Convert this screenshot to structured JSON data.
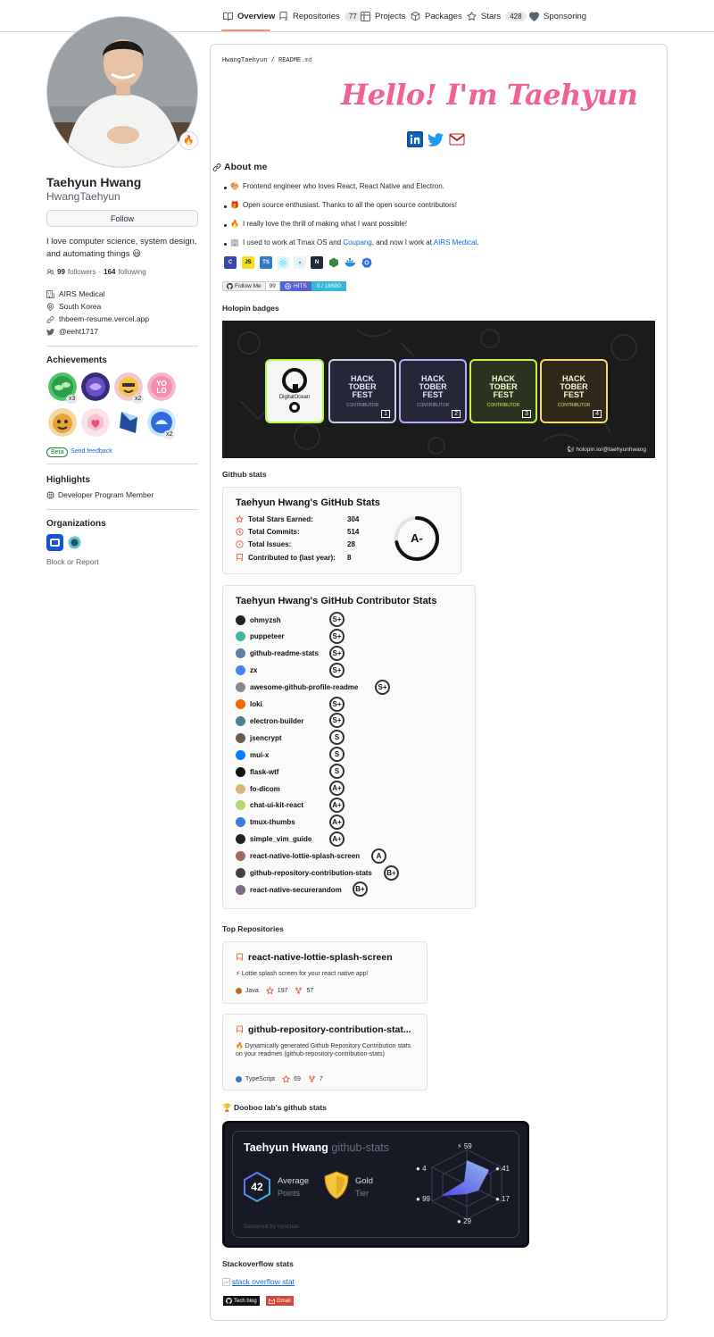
{
  "nav": {
    "overview": "Overview",
    "repositories": "Repositories",
    "repositories_count": "77",
    "projects": "Projects",
    "packages": "Packages",
    "stars": "Stars",
    "stars_count": "428",
    "sponsoring": "Sponsoring"
  },
  "profile": {
    "status_emoji": "🔥",
    "name": "Taehyun Hwang",
    "login": "HwangTaehyun",
    "follow": "Follow",
    "bio": "I love computer science, system design, and automating things 😃",
    "followers_count": "99",
    "followers_label": "followers",
    "separator": "·",
    "following_count": "164",
    "following_label": "following",
    "company": "AIRS Medical",
    "location": "South Korea",
    "website": "thbeem-resume.vercel.app",
    "twitter": "@eeht1717"
  },
  "achievements": {
    "title": "Achievements",
    "badges": [
      {
        "name": "Pair Extraordinaire",
        "count": "x3"
      },
      {
        "name": "Galaxy Brain",
        "count": ""
      },
      {
        "name": "Quickdraw",
        "count": "x2"
      },
      {
        "name": "YOLO",
        "count": ""
      },
      {
        "name": "Starstruck",
        "count": ""
      },
      {
        "name": "Public Sponsor",
        "count": ""
      },
      {
        "name": "Arctic Code Vault",
        "count": ""
      },
      {
        "name": "Pull Shark",
        "count": "x2"
      }
    ],
    "beta": "Beta",
    "feedback": "Send feedback"
  },
  "highlights": {
    "title": "Highlights",
    "item": "Developer Program Member"
  },
  "organizations": {
    "title": "Organizations",
    "block": "Block or Report"
  },
  "readme": {
    "path_user": "HwangTaehyun",
    "path_sep": " / ",
    "path_file": "README",
    "path_ext": ".md",
    "hello": "Hello! I'm Taehyun",
    "about_title": "About me",
    "bullets": [
      {
        "emoji": "🎨",
        "text": "Frontend engineer who loves React, React Native and Electron."
      },
      {
        "emoji": "🎁",
        "text": "Open source enthusiast. Thanks to all the open source contributors!"
      },
      {
        "emoji": "🔥",
        "text": "I really love the thrill of making what I want possible!"
      },
      {
        "emoji": "🏢",
        "text_before": "I used to work at Tmax OS and ",
        "link1": "Coupang",
        "text_mid": ", and now I work at ",
        "link2": "AIRS Medical",
        "text_after": "."
      }
    ],
    "tech_icons": [
      "C",
      "JS",
      "TS",
      "React",
      "Electron",
      "Next",
      "Node",
      "Docker",
      "K8s"
    ],
    "follow_badge_label": "Follow Me",
    "follow_badge_count": "99",
    "hits_label": "HITS",
    "hits_value": "0 / 16680",
    "holopin_title": "Holopin badges",
    "holopin_caption": "holopin.io/@taehyunhwang",
    "holopin_badges": [
      {
        "title": "DigitalOcean",
        "sub": ""
      },
      {
        "title": "HACK TOBER FEST",
        "sub": "CONTRIBUTOR",
        "level": "1"
      },
      {
        "title": "HACK TOBER FEST",
        "sub": "CONTRIBUTOR",
        "level": "2"
      },
      {
        "title": "HACK TOBER FEST",
        "sub": "CONTRIBUTOR",
        "level": "3"
      },
      {
        "title": "HACK TOBER FEST",
        "sub": "CONTRIBUTOR",
        "level": "4"
      }
    ],
    "github_stats_title": "Github stats"
  },
  "stats": {
    "title": "Taehyun Hwang's GitHub Stats",
    "rows": [
      {
        "label": "Total Stars Earned:",
        "value": "304"
      },
      {
        "label": "Total Commits:",
        "value": "514"
      },
      {
        "label": "Total Issues:",
        "value": "28"
      },
      {
        "label": "Contributed to (last year):",
        "value": "8"
      }
    ],
    "grade": "A-",
    "grade_progress": 0.72
  },
  "contrib": {
    "title": "Taehyun Hwang's GitHub Contributor Stats",
    "rows": [
      {
        "name": "ohmyzsh",
        "rank": "S+",
        "color": "#222222"
      },
      {
        "name": "puppeteer",
        "rank": "S+",
        "color": "#40b5a4"
      },
      {
        "name": "github-readme-stats",
        "rank": "S+",
        "color": "#5b7fa6"
      },
      {
        "name": "zx",
        "rank": "S+",
        "color": "#4285f4"
      },
      {
        "name": "awesome-github-profile-readme",
        "rank": "S+",
        "color": "#888888"
      },
      {
        "name": "loki",
        "rank": "S+",
        "color": "#f46800"
      },
      {
        "name": "electron-builder",
        "rank": "S+",
        "color": "#47848f"
      },
      {
        "name": "jsencrypt",
        "rank": "S",
        "color": "#6b5b4b"
      },
      {
        "name": "mui-x",
        "rank": "S",
        "color": "#007fff"
      },
      {
        "name": "flask-wtf",
        "rank": "S",
        "color": "#111111"
      },
      {
        "name": "fo-dicom",
        "rank": "A+",
        "color": "#d7b87a"
      },
      {
        "name": "chat-ui-kit-react",
        "rank": "A+",
        "color": "#b5d96b"
      },
      {
        "name": "tmux-thumbs",
        "rank": "A+",
        "color": "#3b7dd8"
      },
      {
        "name": "simple_vim_guide",
        "rank": "A+",
        "color": "#222222"
      },
      {
        "name": "react-native-lottie-splash-screen",
        "rank": "A",
        "color": "#9c6b5b"
      },
      {
        "name": "github-repository-contribution-stats",
        "rank": "B+",
        "color": "#444444"
      },
      {
        "name": "react-native-securerandom",
        "rank": "B+",
        "color": "#7b6a8a"
      }
    ]
  },
  "top_repos": {
    "title": "Top Repositories",
    "repos": [
      {
        "name": "react-native-lottie-splash-screen",
        "desc": "⚡ Lottie splash screen for your react native app!",
        "lang": "Java",
        "lang_color": "#b07219",
        "stars": "197",
        "forks": "57"
      },
      {
        "name": "github-repository-contribution-stat...",
        "desc": "🔥 Dynamically generated Github Repository Contribution stats on your readmes (github-repository-contribution-stats)",
        "lang": "TypeScript",
        "lang_color": "#3178c6",
        "stars": "69",
        "forks": "7"
      }
    ]
  },
  "dooboo": {
    "section_title": "🏆 Dooboo lab's github stats",
    "name": "Taehyun Hwang",
    "suffix": "github-stats",
    "points": "42",
    "points_label": "Average",
    "points_sub": "Points",
    "tier_label": "Gold",
    "tier_sub": "Tier",
    "radar": {
      "top": "59",
      "upper_right": "41",
      "lower_right": "17",
      "bottom": "29",
      "lower_left": "99",
      "upper_left": "4"
    },
    "footer": "Designed by hyochan"
  },
  "stackoverflow": {
    "title": "Stackoverflow stats",
    "link": "stack overflow stat"
  },
  "footer_badges": {
    "tech_blog": "Tech blog",
    "gmail": "Gmail"
  }
}
